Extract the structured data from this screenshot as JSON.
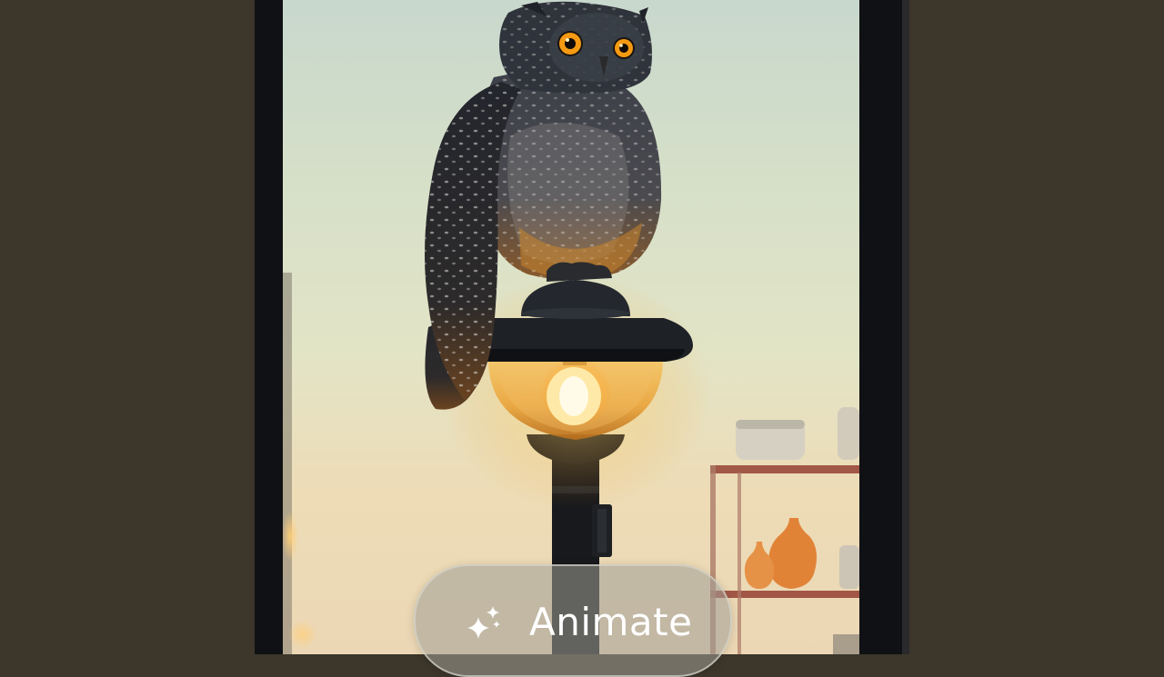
{
  "animate_button": {
    "label": "Animate",
    "icon": "sparkle-icon"
  },
  "colors": {
    "page_background": "#3c362b",
    "frame": "#101114",
    "sky_top": "#c8d8cd",
    "sky_bottom": "#ecd7b5",
    "lamp_glow": "#ffcc55",
    "owl_eye": "#f59a12"
  }
}
